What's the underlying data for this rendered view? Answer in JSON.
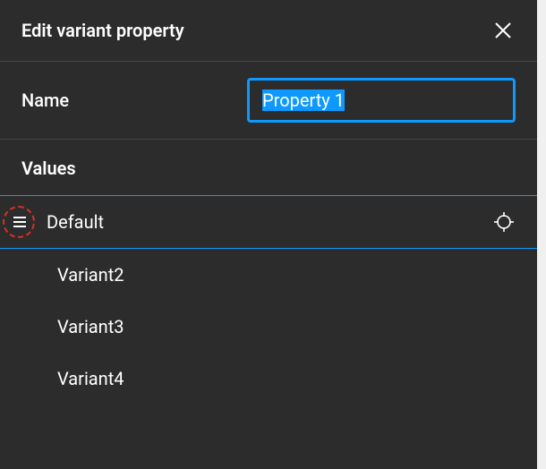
{
  "header": {
    "title": "Edit variant property"
  },
  "name": {
    "label": "Name",
    "value": "Property 1"
  },
  "values": {
    "label": "Values",
    "items": [
      {
        "label": "Default",
        "selected": true
      },
      {
        "label": "Variant2",
        "selected": false
      },
      {
        "label": "Variant3",
        "selected": false
      },
      {
        "label": "Variant4",
        "selected": false
      }
    ]
  }
}
